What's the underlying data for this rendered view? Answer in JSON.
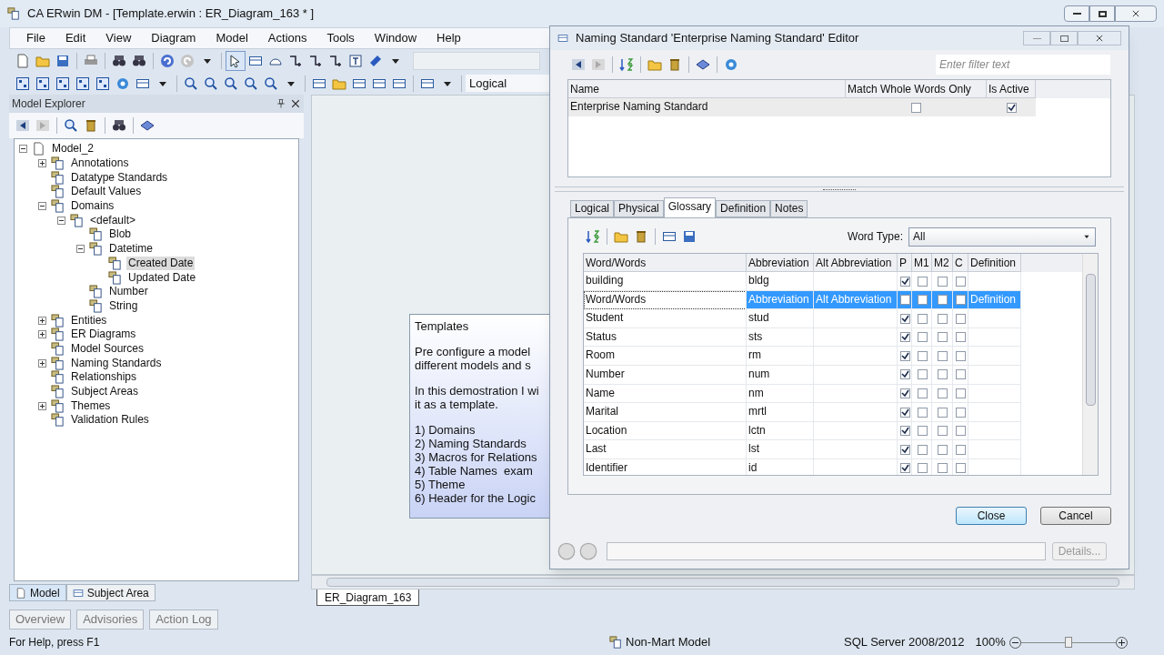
{
  "window": {
    "title": "CA ERwin DM - [Template.erwin : ER_Diagram_163 * ]"
  },
  "menu": [
    "File",
    "Edit",
    "View",
    "Diagram",
    "Model",
    "Actions",
    "Tools",
    "Window",
    "Help"
  ],
  "toolbar": {
    "view_select": "Logical"
  },
  "model_explorer": {
    "title": "Model Explorer",
    "tree": [
      {
        "label": "Model_2",
        "kind": "group",
        "expanded": true,
        "selected": false,
        "children": [
          {
            "label": "Annotations",
            "kind": "group",
            "expanded": false,
            "selected": false
          },
          {
            "label": "Datatype Standards",
            "kind": "leaf",
            "selected": false
          },
          {
            "label": "Default Values",
            "kind": "leaf",
            "selected": false
          },
          {
            "label": "Domains",
            "kind": "group",
            "expanded": true,
            "selected": false,
            "children": [
              {
                "label": "<default>",
                "kind": "group",
                "expanded": true,
                "selected": false,
                "children": [
                  {
                    "label": "Blob",
                    "kind": "leaf",
                    "selected": false
                  },
                  {
                    "label": "Datetime",
                    "kind": "group",
                    "expanded": true,
                    "selected": false,
                    "children": [
                      {
                        "label": "Created Date",
                        "kind": "leaf",
                        "selected": true
                      },
                      {
                        "label": "Updated Date",
                        "kind": "leaf",
                        "selected": false
                      }
                    ]
                  },
                  {
                    "label": "Number",
                    "kind": "leaf",
                    "selected": false
                  },
                  {
                    "label": "String",
                    "kind": "leaf",
                    "selected": false
                  }
                ]
              }
            ]
          },
          {
            "label": "Entities",
            "kind": "group",
            "expanded": false,
            "selected": false
          },
          {
            "label": "ER Diagrams",
            "kind": "group",
            "expanded": false,
            "selected": false
          },
          {
            "label": "Model Sources",
            "kind": "leaf",
            "selected": false
          },
          {
            "label": "Naming Standards",
            "kind": "group",
            "expanded": false,
            "selected": false
          },
          {
            "label": "Relationships",
            "kind": "leaf",
            "selected": false
          },
          {
            "label": "Subject Areas",
            "kind": "leaf",
            "selected": false
          },
          {
            "label": "Themes",
            "kind": "group",
            "expanded": false,
            "selected": false
          },
          {
            "label": "Validation Rules",
            "kind": "leaf",
            "selected": false
          }
        ]
      }
    ],
    "tabs": [
      {
        "label": "Model",
        "selected": true
      },
      {
        "label": "Subject Area",
        "selected": false
      }
    ]
  },
  "diagram": {
    "note": {
      "title": "Templates",
      "paragraphs": [
        [
          "Pre configure a model",
          "different models and s"
        ],
        [
          "In this demostration I wi",
          "it as a template."
        ],
        [
          "1) Domains",
          "2) Naming Standards",
          "3) Macros for Relations",
          "4) Table Names  exam",
          "5) Theme",
          "6) Header for the Logic"
        ]
      ]
    },
    "tabs": [
      {
        "label": "ER_Diagram_163",
        "selected": true
      }
    ]
  },
  "output_tabs": [
    {
      "label": "Overview",
      "selected": false
    },
    {
      "label": "Advisories",
      "selected": false
    },
    {
      "label": "Action Log",
      "selected": false
    }
  ],
  "status_bar": {
    "help": "For Help, press F1",
    "model_type": "Non-Mart Model",
    "database": "SQL Server 2008/2012",
    "zoom": "100%",
    "zoom_slider": {
      "level": 0.5
    }
  },
  "editor": {
    "title": "Naming Standard 'Enterprise Naming Standard' Editor",
    "filter_placeholder": "Enter filter text",
    "columns": [
      "Name",
      "Match Whole Words Only",
      "Is Active"
    ],
    "rows": [
      {
        "name": "Enterprise Naming Standard",
        "match_whole_words_only": false,
        "is_active": true,
        "selected": true
      }
    ],
    "tabs": [
      {
        "label": "Logical",
        "selected": false
      },
      {
        "label": "Physical",
        "selected": false
      },
      {
        "label": "Glossary",
        "selected": true
      },
      {
        "label": "Definition",
        "selected": false
      },
      {
        "label": "Notes",
        "selected": false
      }
    ],
    "word_type": {
      "label": "Word Type:",
      "value": "All"
    },
    "glossary": {
      "columns": [
        "Word/Words",
        "Abbreviation",
        "Alt Abbreviation",
        "P",
        "M1",
        "M2",
        "C",
        "Definition"
      ],
      "rows": [
        {
          "word": "building",
          "abbreviation": "bldg",
          "p": true,
          "m1": false,
          "m2": false,
          "c": false,
          "selected": false
        },
        {
          "word": "Word/Words",
          "abbreviation": "Abbreviation",
          "alt_abbreviation": "Alt Abbreviation",
          "definition": "Definition",
          "p": false,
          "m1": false,
          "m2": false,
          "c": false,
          "selected": true
        },
        {
          "word": "Student",
          "abbreviation": "stud",
          "p": true,
          "m1": false,
          "m2": false,
          "c": false,
          "selected": false
        },
        {
          "word": "Status",
          "abbreviation": "sts",
          "p": true,
          "m1": false,
          "m2": false,
          "c": false,
          "selected": false
        },
        {
          "word": "Room",
          "abbreviation": "rm",
          "p": true,
          "m1": false,
          "m2": false,
          "c": false,
          "selected": false
        },
        {
          "word": "Number",
          "abbreviation": "num",
          "p": true,
          "m1": false,
          "m2": false,
          "c": false,
          "selected": false
        },
        {
          "word": "Name",
          "abbreviation": "nm",
          "p": true,
          "m1": false,
          "m2": false,
          "c": false,
          "selected": false
        },
        {
          "word": "Marital",
          "abbreviation": "mrtl",
          "p": true,
          "m1": false,
          "m2": false,
          "c": false,
          "selected": false
        },
        {
          "word": "Location",
          "abbreviation": "lctn",
          "p": true,
          "m1": false,
          "m2": false,
          "c": false,
          "selected": false
        },
        {
          "word": "Last",
          "abbreviation": "lst",
          "p": true,
          "m1": false,
          "m2": false,
          "c": false,
          "selected": false
        },
        {
          "word": "Identifier",
          "abbreviation": "id",
          "p": true,
          "m1": false,
          "m2": false,
          "c": false,
          "selected": false
        }
      ]
    },
    "buttons": [
      {
        "label": "Close",
        "default": true
      },
      {
        "label": "Cancel",
        "default": false
      }
    ],
    "details_button": {
      "label": "Details...",
      "disabled": true
    }
  }
}
